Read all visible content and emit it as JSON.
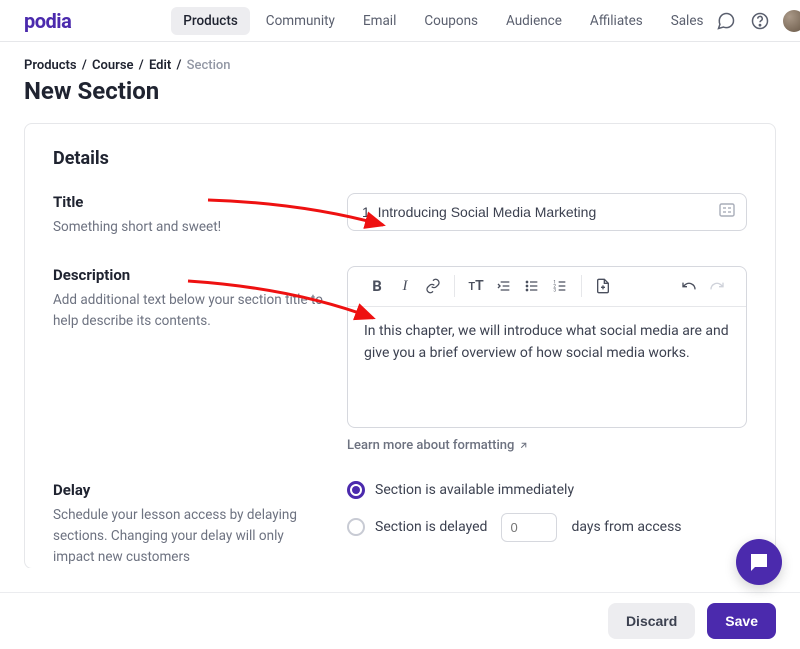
{
  "brand": "podia",
  "nav": {
    "items": [
      "Products",
      "Community",
      "Email",
      "Coupons",
      "Audience",
      "Affiliates",
      "Sales"
    ],
    "active_index": 0
  },
  "breadcrumb": {
    "segments": [
      "Products",
      "Course",
      "Edit"
    ],
    "current": "Section"
  },
  "page_title": "New Section",
  "details_title": "Details",
  "title_section": {
    "label": "Title",
    "help": "Something short and sweet!",
    "value": "1. Introducing Social Media Marketing"
  },
  "description_section": {
    "label": "Description",
    "help": "Add additional text below your section title to help describe its contents.",
    "body": "In this chapter, we will introduce what social media are and give you a brief overview of how social media works.",
    "learn_more": "Learn more about formatting"
  },
  "delay_section": {
    "label": "Delay",
    "help": "Schedule your lesson access by delaying sections. Changing your delay will only impact new customers",
    "option_immediate": "Section is available immediately",
    "option_delayed_pre": "Section is delayed",
    "option_delayed_post": "days from access",
    "days_placeholder": "0"
  },
  "footer": {
    "discard": "Discard",
    "save": "Save"
  },
  "colors": {
    "accent": "#4b2aad"
  }
}
